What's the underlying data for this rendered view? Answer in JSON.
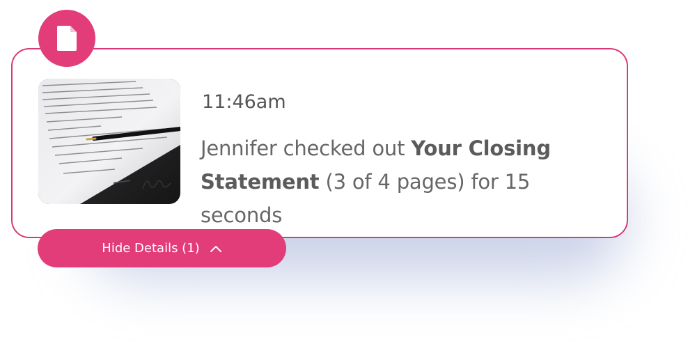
{
  "notification": {
    "badge_icon": "document-icon",
    "time": "11:46am",
    "message": {
      "prefix": "Jennifer checked out ",
      "document_name": "Your Closing Statement",
      "suffix": " (3 of 4 pages) for 15 seconds"
    },
    "thumbnail": "signed-document-with-pen-photo"
  },
  "toggle": {
    "label": "Hide Details (1)",
    "icon": "chevron-up-icon"
  },
  "colors": {
    "accent": "#e23c79",
    "border": "#d93a77",
    "text": "#666666"
  }
}
